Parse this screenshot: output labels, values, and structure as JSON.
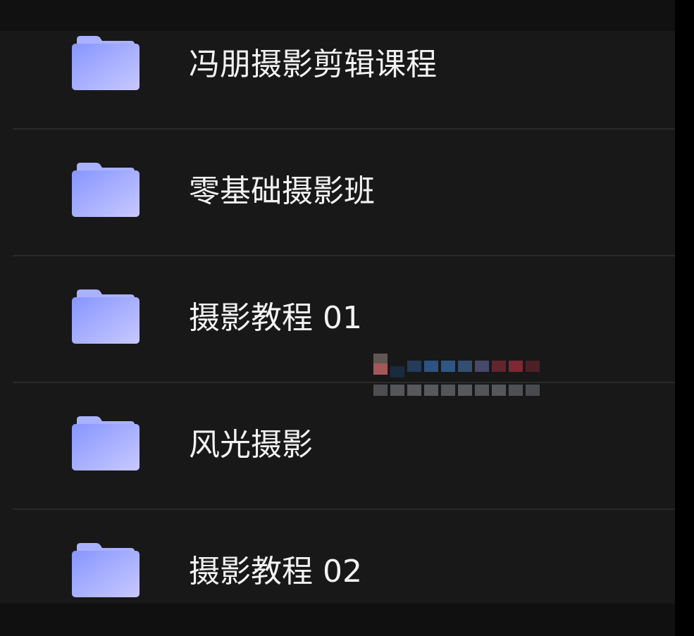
{
  "list": {
    "items": [
      {
        "name": "冯朋摄影剪辑课程",
        "icon": "folder-icon"
      },
      {
        "name": "零基础摄影班",
        "icon": "folder-icon"
      },
      {
        "name": "摄影教程 01",
        "icon": "folder-icon"
      },
      {
        "name": "风光摄影",
        "icon": "folder-icon"
      },
      {
        "name": "摄影教程 02",
        "icon": "folder-icon"
      }
    ]
  },
  "colors": {
    "background": "#181819",
    "text": "#f2f2f2",
    "divider": "#2a2a2b",
    "folder_light": "#9aa7ff",
    "folder_dark": "#7f8ef7"
  }
}
